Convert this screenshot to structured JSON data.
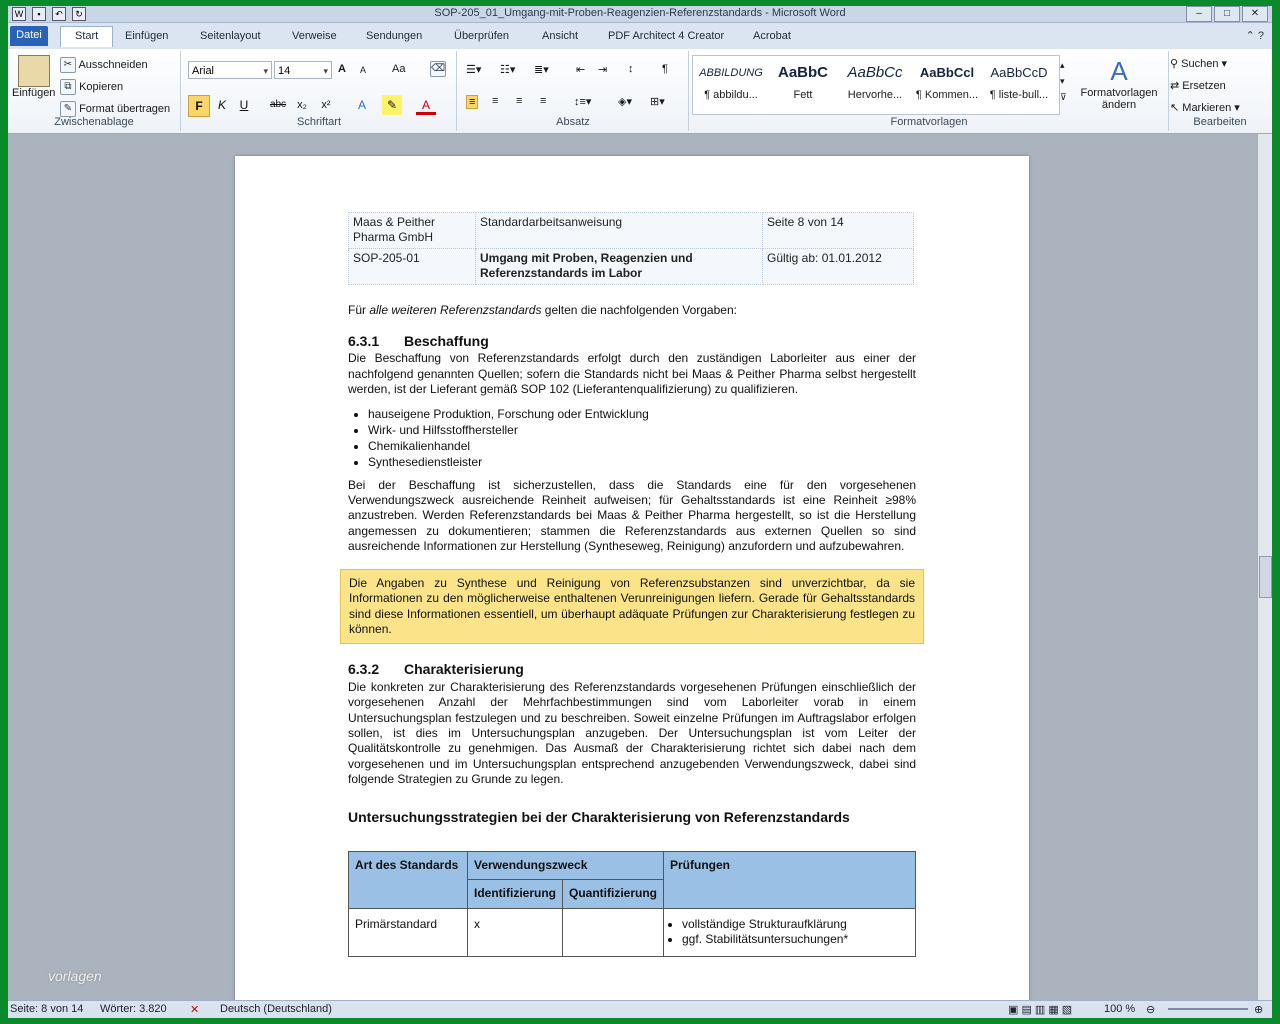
{
  "window": {
    "title": "SOP-205_01_Umgang-mit-Proben-Reagenzien-Referenzstandards - Microsoft Word"
  },
  "tabs": [
    {
      "label": "Datei"
    },
    {
      "label": "Start"
    },
    {
      "label": "Einfügen"
    },
    {
      "label": "Seitenlayout"
    },
    {
      "label": "Verweise"
    },
    {
      "label": "Sendungen"
    },
    {
      "label": "Überprüfen"
    },
    {
      "label": "Ansicht"
    },
    {
      "label": "PDF Architect 4 Creator"
    },
    {
      "label": "Acrobat"
    }
  ],
  "ribbon": {
    "clipboard": {
      "label": "Zwischenablage",
      "paste": "Einfügen",
      "cut": "Ausschneiden",
      "copy": "Kopieren",
      "format": "Format übertragen"
    },
    "font": {
      "label": "Schriftart",
      "family": "Arial",
      "size": "14",
      "bold": "F",
      "italic": "K",
      "underline": "U",
      "strike": "abc",
      "sub": "x₂",
      "sup": "x²",
      "grow": "A",
      "shrink": "A",
      "case": "Aa"
    },
    "paragraph": {
      "label": "Absatz"
    },
    "styles": {
      "label": "Formatvorlagen",
      "items": [
        {
          "preview": "ABBILDUNG",
          "name": "¶ abbildu..."
        },
        {
          "preview": "AaBbC",
          "name": "Fett"
        },
        {
          "preview": "AaBbCc",
          "name": "Hervorhe..."
        },
        {
          "preview": "AaBbCcl",
          "name": "¶ Kommen..."
        },
        {
          "preview": "AaBbCcD",
          "name": "¶ liste-bull..."
        }
      ],
      "change": "Formatvorlagen ändern"
    },
    "edit": {
      "label": "Bearbeiten",
      "find": "Suchen",
      "replace": "Ersetzen",
      "select": "Markieren"
    }
  },
  "header": {
    "company": "Maas & Peither Pharma GmbH",
    "type": "Standardarbeitsanweisung",
    "page": "Seite 8 von 14",
    "id": "SOP-205-01",
    "subject": "Umgang mit Proben, Reagenzien und Referenzstandards im Labor",
    "valid": "Gültig ab: 01.01.2012"
  },
  "doc": {
    "intro_pre": "Für ",
    "intro_em": "alle weiteren Referenzstandards",
    "intro_post": " gelten die nachfolgenden Vorgaben:",
    "s1_num": "6.3.1",
    "s1_title": "Beschaffung",
    "s1_p1": "Die Beschaffung von Referenzstandards erfolgt durch den zuständigen Laborleiter aus einer der nachfolgend genannten Quellen; sofern die Standards nicht bei Maas & Peither Pharma selbst hergestellt werden, ist der Lieferant gemäß SOP 102 (Lieferantenqualifizierung) zu qualifizieren.",
    "bullets": [
      "hauseigene Produktion, Forschung oder Entwicklung",
      "Wirk- und Hilfsstoffhersteller",
      "Chemikalienhandel",
      "Synthesedienstleister"
    ],
    "s1_p2": "Bei der Beschaffung ist sicherzustellen, dass die Standards eine für den vorgesehenen Verwendungszweck ausreichende Reinheit aufweisen; für Gehaltsstandards ist eine Reinheit ≥98% anzustreben. Werden Referenzstandards bei Maas & Peither Pharma hergestellt, so ist die Herstellung angemessen zu dokumentieren; stammen die Referenzstandards aus externen Quellen so sind ausreichende Informationen zur Herstellung (Syntheseweg, Reinigung) anzufordern und aufzubewahren.",
    "note": "Die Angaben zu Synthese und Reinigung von Referenzsubstanzen sind unverzichtbar, da sie Informationen zu den möglicherweise enthaltenen Verunreinigungen liefern. Gerade für Gehaltsstandards sind diese Informationen essentiell, um überhaupt adäquate Prüfungen zur Charakterisierung festlegen zu können.",
    "s2_num": "6.3.2",
    "s2_title": "Charakterisierung",
    "s2_p1": "Die konkreten zur Charakterisierung des Referenzstandards vorgesehenen Prüfungen einschließlich der vorgesehenen Anzahl der Mehrfachbestimmungen sind vom Laborleiter vorab in einem Untersuchungsplan festzulegen und zu beschreiben. Soweit einzelne Prüfungen im Auftragslabor erfolgen sollen, ist dies im Untersuchungsplan anzugeben. Der Untersuchungsplan ist vom Leiter der Qualitätskontrolle zu genehmigen. Das Ausmaß der Charakterisierung richtet sich dabei nach dem vorgesehenen und im Untersuchungsplan entsprechend anzugebenden Verwendungszweck, dabei sind folgende Strategien zu Grunde zu legen.",
    "table_title": "Untersuchungsstrategien bei der Charakterisierung von Referenzstandards",
    "table": {
      "h_art": "Art des Standards",
      "h_zweck": "Verwendungszweck",
      "h_pruef": "Prüfungen",
      "h_ident": "Identifizierung",
      "h_quant": "Quantifizierung",
      "r1_art": "Primärstandard",
      "r1_ident": "x",
      "r1_quant": "",
      "r1_items": [
        "vollständige Strukturaufklärung",
        "ggf. Stabilitätsuntersuchungen*"
      ]
    }
  },
  "status": {
    "page": "Seite: 8 von 14",
    "words": "Wörter: 3.820",
    "lang": "Deutsch (Deutschland)",
    "zoom": "100 %"
  },
  "watermark": "vorlagen"
}
